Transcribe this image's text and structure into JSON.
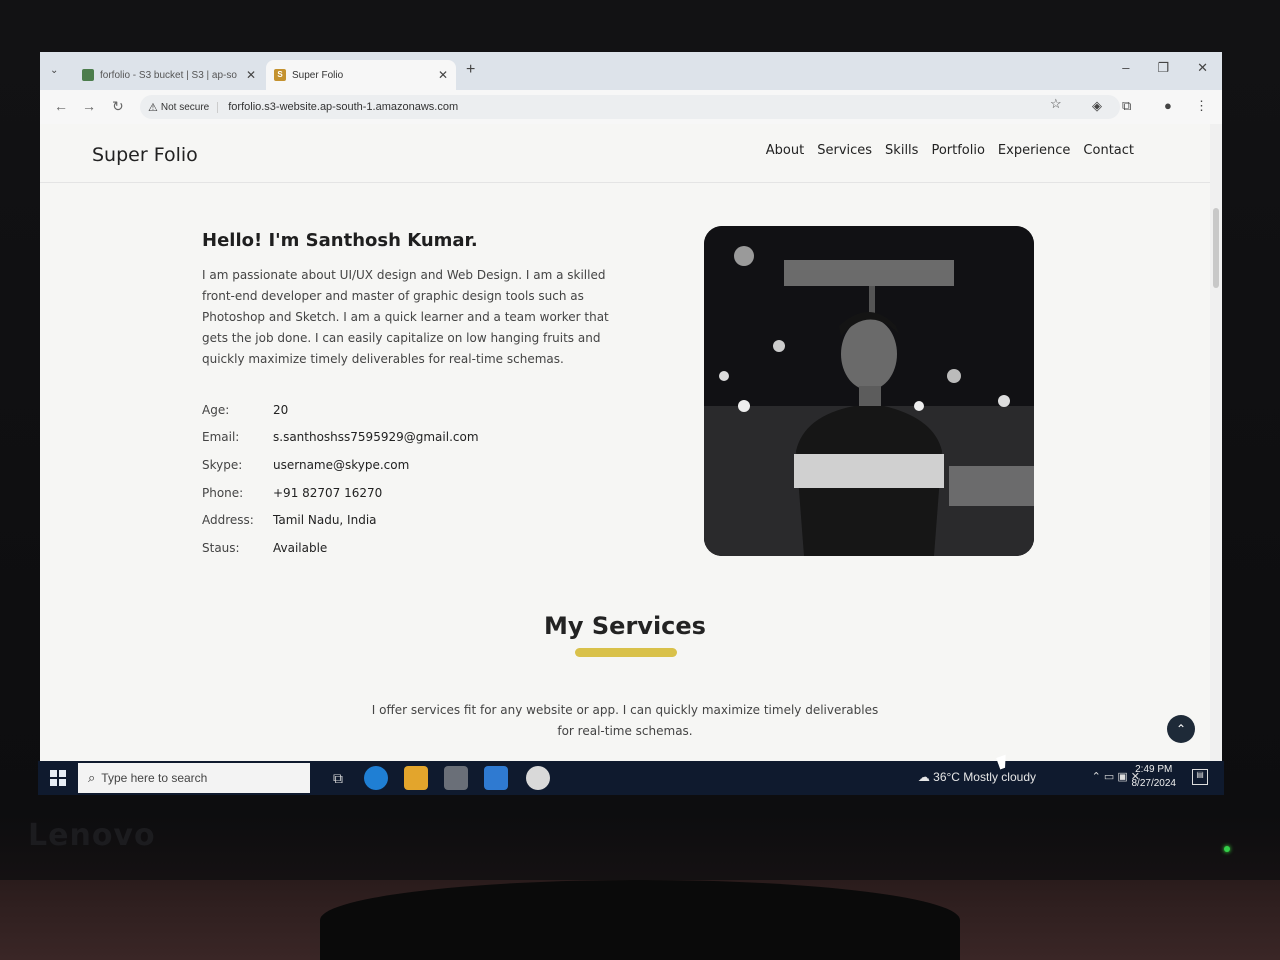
{
  "browser": {
    "tabs": [
      {
        "title": "forfolio - S3 bucket | S3 | ap-so",
        "active": false
      },
      {
        "title": "Super Folio",
        "active": true
      }
    ],
    "new_tab": "+",
    "security_label": "Not secure",
    "url": "forfolio.s3-website.ap-south-1.amazonaws.com"
  },
  "site": {
    "logo": "Super Folio",
    "menu": [
      "About",
      "Services",
      "Skills",
      "Portfolio",
      "Experience",
      "Contact"
    ]
  },
  "about": {
    "heading": "Hello! I'm Santhosh Kumar.",
    "bio": "I am passionate about UI/UX design and Web Design. I am a skilled front-end developer and master of graphic design tools such as Photoshop and Sketch. I am a quick learner and a team worker that gets the job done. I can easily capitalize on low hanging fruits and quickly maximize timely deliverables for real-time schemas.",
    "info": [
      {
        "label": "Age:",
        "value": "20"
      },
      {
        "label": "Email:",
        "value": "s.santhoshss7595929@gmail.com"
      },
      {
        "label": "Skype:",
        "value": "username@skype.com"
      },
      {
        "label": "Phone:",
        "value": "+91 82707 16270"
      },
      {
        "label": "Address:",
        "value": "Tamil Nadu, India"
      },
      {
        "label": "Staus:",
        "value": "Available"
      }
    ]
  },
  "services": {
    "title": "My Services",
    "description_line1": "I offer services fit for any website or app. I can quickly maximize timely deliverables",
    "description_line2": "for real-time schemas."
  },
  "taskbar": {
    "search_placeholder": "Type here to search",
    "weather": "36°C  Mostly cloudy",
    "time": "2:49 PM",
    "date": "8/27/2024"
  },
  "monitor": {
    "brand": "Lenovo"
  },
  "colors": {
    "accent_underline": "#d9c14a",
    "taskbar": "#0f1a2e",
    "page_bg": "#f6f6f4"
  }
}
